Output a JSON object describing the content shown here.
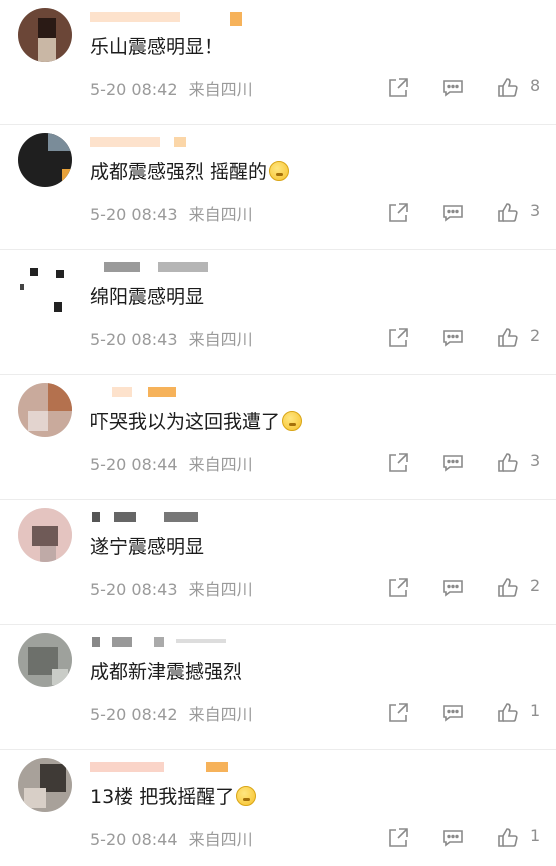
{
  "comments": [
    {
      "text": "乐山震感明显！",
      "date": "5-20 08:42",
      "source": "来自四川",
      "likes": "8",
      "emoji": false
    },
    {
      "text": "成都震感强烈  摇醒的",
      "date": "5-20 08:43",
      "source": "来自四川",
      "likes": "3",
      "emoji": true
    },
    {
      "text": "绵阳震感明显",
      "date": "5-20 08:43",
      "source": "来自四川",
      "likes": "2",
      "emoji": false
    },
    {
      "text": "吓哭我以为这回我遭了",
      "date": "5-20 08:44",
      "source": "来自四川",
      "likes": "3",
      "emoji": true
    },
    {
      "text": "遂宁震感明显",
      "date": "5-20 08:43",
      "source": "来自四川",
      "likes": "2",
      "emoji": false
    },
    {
      "text": "成都新津震撼强烈",
      "date": "5-20 08:42",
      "source": "来自四川",
      "likes": "1",
      "emoji": false
    },
    {
      "text": "13楼  把我摇醒了",
      "date": "5-20 08:44",
      "source": "来自四川",
      "likes": "1",
      "emoji": true
    }
  ],
  "icons": {
    "share": "share-icon",
    "comment": "comment-icon",
    "like": "thumbs-up-icon"
  },
  "colors": {
    "meta_text": "#9a9a9a",
    "icon": "#8a8a8a",
    "name_blur": "#f3a34a"
  }
}
